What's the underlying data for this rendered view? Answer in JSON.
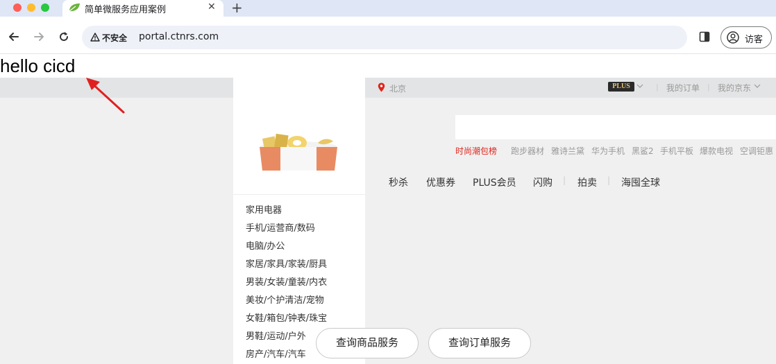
{
  "browser": {
    "tab_title": "简单微服务应用案例",
    "tab_close": "✕",
    "new_tab": "+",
    "security_label": "不安全",
    "url": "portal.ctnrs.com",
    "profile_label": "访客"
  },
  "page": {
    "hello_text": "hello cicd"
  },
  "topbar": {
    "location": "北京",
    "plus_badge": "PLUS",
    "links": [
      "我的订单",
      "我的京东"
    ],
    "separator": "|"
  },
  "sidebar": {
    "categories": [
      "家用电器",
      "手机/运营商/数码",
      "电脑/办公",
      "家居/家具/家装/厨具",
      "男装/女装/童装/内衣",
      "美妆/个护清洁/宠物",
      "女鞋/箱包/钟表/珠宝",
      "男鞋/运动/户外",
      "房产/汽车/汽车"
    ]
  },
  "search": {
    "hot_words": [
      "时尚潮包榜",
      "跑步器材",
      "雅诗兰黛",
      "华为手机",
      "黑鲨2",
      "手机平板",
      "爆款电视",
      "空调钜惠"
    ]
  },
  "main_nav": {
    "items": [
      "秒杀",
      "优惠券",
      "PLUS会员",
      "闪购",
      "拍卖",
      "海囤全球"
    ]
  },
  "actions": {
    "query_products": "查询商品服务",
    "query_orders": "查询订单服务"
  },
  "colors": {
    "accent_red": "#e1251b",
    "topbar_bg": "#e3e4e5",
    "tabbar_bg": "#dfe6f5"
  }
}
